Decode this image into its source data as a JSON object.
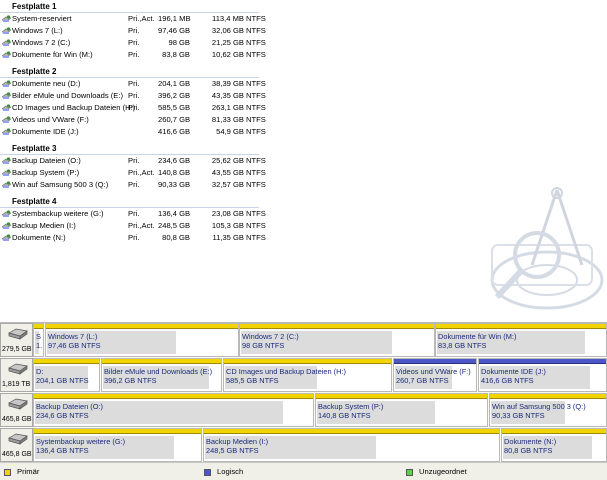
{
  "colors": {
    "primary": "#f1d400",
    "logical": "#4d56c8",
    "unallocated": "#5cd24a"
  },
  "groups": [
    {
      "title": "Festplatte 1",
      "volumes": [
        {
          "name": "System-reserviert",
          "type": "Pri.,Act.",
          "capacity": "196,1 MB",
          "free": "113,4 MB",
          "fs": "NTFS"
        },
        {
          "name": "Windows 7 (L:)",
          "type": "Pri.",
          "capacity": "97,46 GB",
          "free": "32,06 GB",
          "fs": "NTFS"
        },
        {
          "name": "Windows 7 2 (C:)",
          "type": "Pri.",
          "capacity": "98 GB",
          "free": "21,25 GB",
          "fs": "NTFS"
        },
        {
          "name": "Dokumente für Win (M:)",
          "type": "Pri.",
          "capacity": "83,8 GB",
          "free": "10,62 GB",
          "fs": "NTFS"
        }
      ]
    },
    {
      "title": "Festplatte 2",
      "volumes": [
        {
          "name": "Dokumente neu (D:)",
          "type": "Pri.",
          "capacity": "204,1 GB",
          "free": "38,39 GB",
          "fs": "NTFS"
        },
        {
          "name": "Bilder eMule und Downloads (E:)",
          "type": "Pri.",
          "capacity": "396,2 GB",
          "free": "43,35 GB",
          "fs": "NTFS"
        },
        {
          "name": "CD Images und Backup Dateien (H:)",
          "type": "Pri.",
          "capacity": "585,5 GB",
          "free": "263,1 GB",
          "fs": "NTFS"
        },
        {
          "name": "Videos und VWare (F:)",
          "type": "",
          "capacity": "260,7 GB",
          "free": "81,33 GB",
          "fs": "NTFS"
        },
        {
          "name": "Dokumente IDE (J:)",
          "type": "",
          "capacity": "416,6 GB",
          "free": "54,9 GB",
          "fs": "NTFS"
        }
      ]
    },
    {
      "title": "Festplatte 3",
      "volumes": [
        {
          "name": "Backup Dateien (O:)",
          "type": "Pri.",
          "capacity": "234,6 GB",
          "free": "25,62 GB",
          "fs": "NTFS"
        },
        {
          "name": "Backup System (P:)",
          "type": "Pri.,Act.",
          "capacity": "140,8 GB",
          "free": "43,55 GB",
          "fs": "NTFS"
        },
        {
          "name": "Win auf Samsung 500 3 (Q:)",
          "type": "Pri.",
          "capacity": "90,33 GB",
          "free": "32,57 GB",
          "fs": "NTFS"
        }
      ]
    },
    {
      "title": "Festplatte 4",
      "volumes": [
        {
          "name": "Systembackup weitere (G:)",
          "type": "Pri.",
          "capacity": "136,4 GB",
          "free": "23,08 GB",
          "fs": "NTFS"
        },
        {
          "name": "Backup Medien (I:)",
          "type": "Pri.,Act.",
          "capacity": "248,5 GB",
          "free": "105,3 GB",
          "fs": "NTFS"
        },
        {
          "name": "Dokumente (N:)",
          "type": "Pri.",
          "capacity": "80,8 GB",
          "free": "11,35 GB",
          "fs": "NTFS"
        }
      ]
    }
  ],
  "disks": [
    {
      "size": "279,5 GB",
      "partitions": [
        {
          "line1": "S",
          "line2": "1.",
          "kind": "primary",
          "used": 0.42
        },
        {
          "line1": "Windows 7 (L:)",
          "line2": "97,46 GB  NTFS",
          "kind": "primary",
          "used": 0.67
        },
        {
          "line1": "Windows 7 2 (C:)",
          "line2": "98 GB  NTFS",
          "kind": "primary",
          "used": 0.78
        },
        {
          "line1": "Dokumente für Win (M:)",
          "line2": "83,8 GB  NTFS",
          "kind": "primary",
          "used": 0.87
        }
      ]
    },
    {
      "size": "1,819 TB",
      "partitions": [
        {
          "line1": "D:",
          "line2": "204,1 GB  NTFS",
          "kind": "primary",
          "used": 0.81
        },
        {
          "line1": "Bilder eMule und Downloads (E:)",
          "line2": "396,2 GB  NTFS",
          "kind": "primary",
          "used": 0.89
        },
        {
          "line1": "CD Images und Backup Dateien (H:)",
          "line2": "585,5 GB  NTFS",
          "kind": "primary",
          "used": 0.55
        },
        {
          "line1": "Videos und VWare (F:)",
          "line2": "260,7 GB  NTFS",
          "kind": "logical",
          "used": 0.69
        },
        {
          "line1": "Dokumente IDE (J:)",
          "line2": "416,6 GB  NTFS",
          "kind": "logical",
          "used": 0.87
        }
      ]
    },
    {
      "size": "465,8 GB",
      "partitions": [
        {
          "line1": "Backup Dateien (O:)",
          "line2": "234,6 GB  NTFS",
          "kind": "primary",
          "used": 0.89
        },
        {
          "line1": "Backup System (P:)",
          "line2": "140,8 GB  NTFS",
          "kind": "primary",
          "used": 0.69
        },
        {
          "line1": "Win auf Samsung 500 3 (Q:)",
          "line2": "90,33 GB  NTFS",
          "kind": "primary",
          "used": 0.64
        }
      ]
    },
    {
      "size": "465,8 GB",
      "partitions": [
        {
          "line1": "Systembackup weitere (G:)",
          "line2": "136,4 GB  NTFS",
          "kind": "primary",
          "used": 0.83
        },
        {
          "line1": "Backup Medien (I:)",
          "line2": "248,5 GB  NTFS",
          "kind": "primary",
          "used": 0.58
        },
        {
          "line1": "Dokumente (N:)",
          "line2": "80,8 GB  NTFS",
          "kind": "primary",
          "used": 0.86
        }
      ]
    }
  ],
  "legend": {
    "primary": "Primär",
    "logical": "Logisch",
    "unallocated": "Unzugeordnet"
  }
}
